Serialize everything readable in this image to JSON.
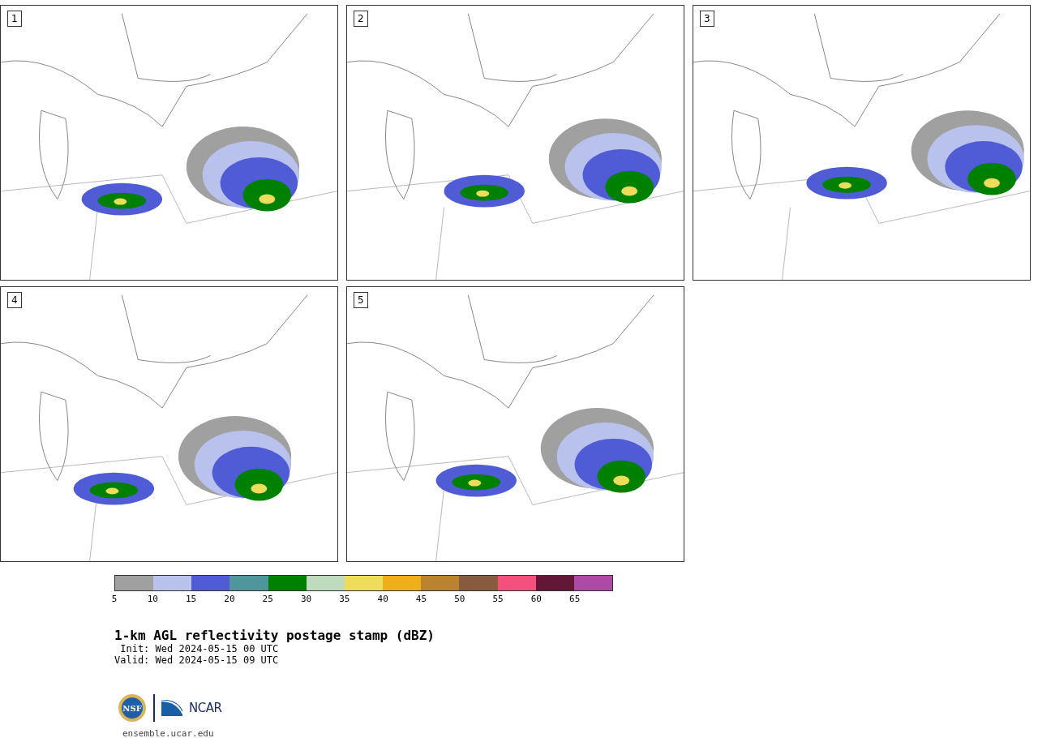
{
  "panels": [
    {
      "label": "1"
    },
    {
      "label": "2"
    },
    {
      "label": "3"
    },
    {
      "label": "4"
    },
    {
      "label": "5"
    }
  ],
  "colorbar": {
    "colors": [
      {
        "color": "#a0a0a0"
      },
      {
        "color": "#b8c2ec"
      },
      {
        "color": "#505cd6"
      },
      {
        "color": "#4f969c"
      },
      {
        "color": "#008000"
      },
      {
        "color": "#bedbbd"
      },
      {
        "color": "#eedc5a"
      },
      {
        "color": "#efaf18"
      },
      {
        "color": "#ba832f"
      },
      {
        "color": "#885a3e"
      },
      {
        "color": "#f4507d"
      },
      {
        "color": "#611735"
      },
      {
        "color": "#ad4aa5"
      }
    ],
    "ticks": [
      "5",
      "10",
      "15",
      "20",
      "25",
      "30",
      "35",
      "40",
      "45",
      "50",
      "55",
      "60",
      "65"
    ]
  },
  "title": "1-km AGL reflectivity postage stamp (dBZ)",
  "init": " Init: Wed 2024-05-15 00 UTC",
  "valid": "Valid: Wed 2024-05-15 09 UTC",
  "logo": {
    "nsf_text": "NSF",
    "ncar_text": "NCAR"
  },
  "footer_link": "ensemble.ucar.edu"
}
